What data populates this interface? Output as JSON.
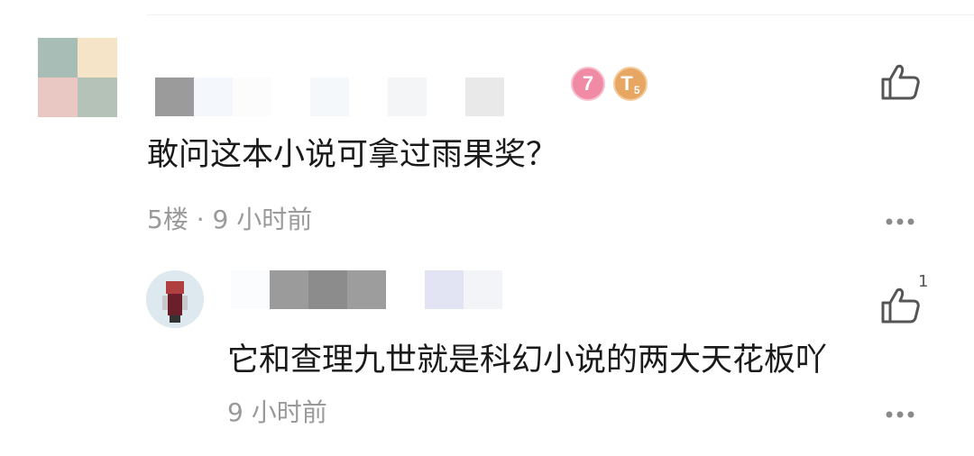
{
  "comments": [
    {
      "text": "敢问这本小说可拿过雨果奖？",
      "floor_time": "5楼 · 9 小时前",
      "badges": {
        "level": "7",
        "tag": "T",
        "tag_sub": "5"
      },
      "reply": {
        "text": "它和查理九世就是科幻小说的两大天花板吖",
        "time": "9 小时前",
        "like_count": "1"
      }
    }
  ],
  "colors": {
    "text_primary": "#1a1a1a",
    "text_secondary": "#9a9a9a",
    "icon": "#555555",
    "badge_level": "#f08aa5",
    "badge_tag": "#e8a663"
  },
  "icons": [
    "thumbs-up-icon",
    "more-icon"
  ]
}
